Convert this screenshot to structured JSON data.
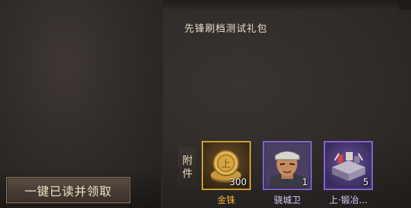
{
  "left": {
    "read_all_button": "一键已读并领取"
  },
  "mail": {
    "title": "先锋刷档测试礼包"
  },
  "attachments": {
    "label": "附件",
    "items": [
      {
        "name": "金铢",
        "quantity": "300",
        "icon": "gold-coin-icon",
        "rarity_color": "#d5a53a"
      },
      {
        "name": "骁城卫",
        "quantity": "1",
        "icon": "hero-portrait-icon",
        "rarity_color": "#7d62c9"
      },
      {
        "name": "上·锻冶...",
        "quantity": "5",
        "icon": "forging-chest-icon",
        "rarity_color": "#8a66d8"
      }
    ]
  }
}
